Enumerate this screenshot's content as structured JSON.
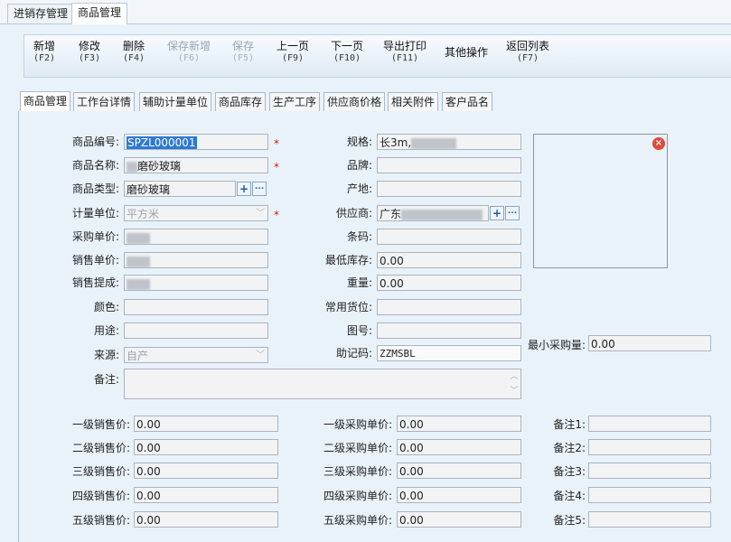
{
  "top_tabs": [
    {
      "label": "进销存管理"
    },
    {
      "label": "商品管理"
    }
  ],
  "toolbar": {
    "buttons": [
      {
        "label": "新增",
        "key": "(F2)",
        "enabled": true
      },
      {
        "label": "修改",
        "key": "(F3)",
        "enabled": true
      },
      {
        "label": "删除",
        "key": "(F4)",
        "enabled": true
      },
      {
        "label": "保存新增",
        "key": "(F6)",
        "enabled": false
      },
      {
        "label": "保存",
        "key": "(F5)",
        "enabled": false
      },
      {
        "label": "上一页",
        "key": "(F9)",
        "enabled": true
      },
      {
        "label": "下一页",
        "key": "(F10)",
        "enabled": true
      },
      {
        "label": "导出打印",
        "key": "(F11)",
        "enabled": true
      },
      {
        "label": "其他操作",
        "key": "",
        "enabled": true
      },
      {
        "label": "返回列表",
        "key": "(F7)",
        "enabled": true
      }
    ]
  },
  "sub_tabs": [
    {
      "label": "商品管理"
    },
    {
      "label": "工作台详情"
    },
    {
      "label": "辅助计量单位"
    },
    {
      "label": "商品库存"
    },
    {
      "label": "生产工序"
    },
    {
      "label": "供应商价格"
    },
    {
      "label": "相关附件"
    },
    {
      "label": "客户品名"
    }
  ],
  "form": {
    "code_label": "商品编号:",
    "code_value": "SPZL000001",
    "name_label": "商品名称:",
    "name_value": "磨砂玻璃",
    "type_label": "商品类型:",
    "type_value": "磨砂玻璃",
    "unit_label": "计量单位:",
    "unit_value": "平方米",
    "purchase_price_label": "采购单价:",
    "sale_price_label": "销售单价:",
    "commission_label": "销售提成:",
    "color_label": "颜色:",
    "usage_label": "用途:",
    "source_label": "来源:",
    "source_value": "自产",
    "remark_label": "备注:",
    "spec_label": "规格:",
    "spec_value": "长3m,",
    "brand_label": "品牌:",
    "origin_label": "产地:",
    "supplier_label": "供应商:",
    "supplier_value": "广东",
    "barcode_label": "条码:",
    "min_stock_label": "最低库存:",
    "min_stock_value": "0.00",
    "weight_label": "重量:",
    "weight_value": "0.00",
    "location_label": "常用货位:",
    "drawing_no_label": "图号:",
    "mnemonic_label": "助记码:",
    "mnemonic_value": "ZZMSBL",
    "min_purchase_label": "最小采购量:",
    "min_purchase_value": "0.00",
    "required_mark": "*",
    "plus_glyph": "+",
    "more_glyph": "...",
    "close_glyph": "×",
    "caret_glyph": "﹀",
    "scroll_up": "︿",
    "scroll_down": "﹀"
  },
  "price_levels": [
    {
      "sale_label": "一级销售价:",
      "sale_value": "0.00",
      "purchase_label": "一级采购单价:",
      "purchase_value": "0.00",
      "note_label": "备注1:"
    },
    {
      "sale_label": "二级销售价:",
      "sale_value": "0.00",
      "purchase_label": "二级采购单价:",
      "purchase_value": "0.00",
      "note_label": "备注2:"
    },
    {
      "sale_label": "三级销售价:",
      "sale_value": "0.00",
      "purchase_label": "三级采购单价:",
      "purchase_value": "0.00",
      "note_label": "备注3:"
    },
    {
      "sale_label": "四级销售价:",
      "sale_value": "0.00",
      "purchase_label": "四级采购单价:",
      "purchase_value": "0.00",
      "note_label": "备注4:"
    },
    {
      "sale_label": "五级销售价:",
      "sale_value": "0.00",
      "purchase_label": "五级采购单价:",
      "purchase_value": "0.00",
      "note_label": "备注5:"
    }
  ],
  "colors": {
    "accent": "#2f78d4",
    "required": "#d21c1c",
    "close": "#e14b3b",
    "background": "#eaf2f9"
  }
}
